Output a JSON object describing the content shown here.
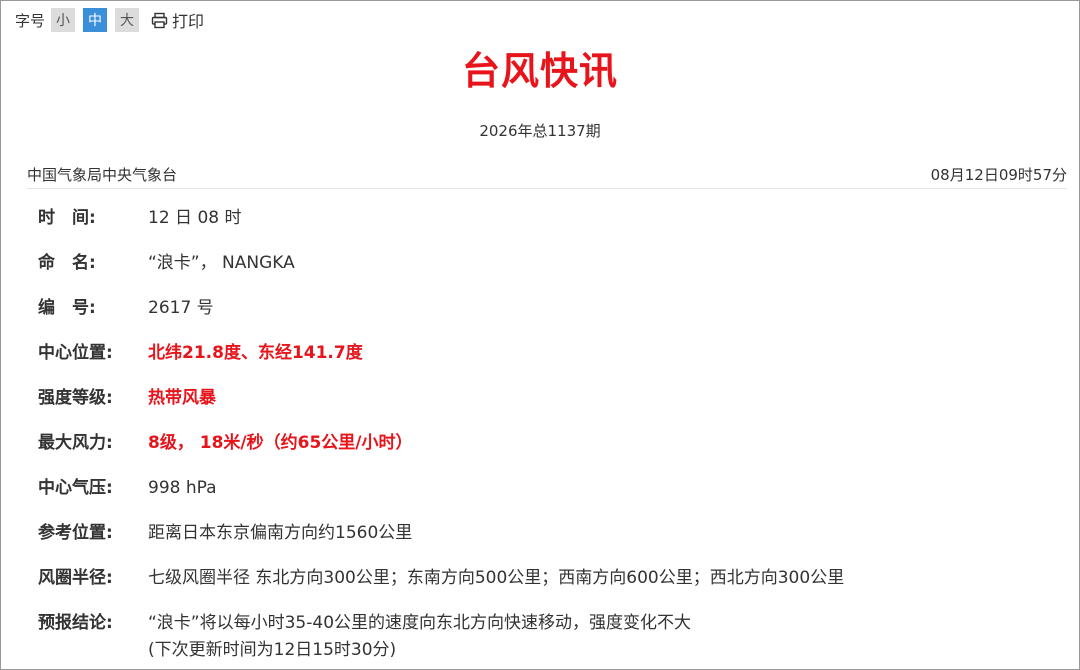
{
  "toolbar": {
    "font_size_label": "字号",
    "sizes": [
      {
        "label": "小",
        "active": false
      },
      {
        "label": "中",
        "active": true
      },
      {
        "label": "大",
        "active": false
      }
    ],
    "print_label": "打印",
    "print_icon": "printer-icon"
  },
  "header": {
    "title": "台风快讯",
    "issue": "2026年总1137期",
    "source": "中国气象局中央气象台",
    "publish_time": "08月12日09时57分"
  },
  "fields": [
    {
      "key": "时　间:",
      "value": "12 日 08 时"
    },
    {
      "key": "命　名:",
      "value": "“浪卡”， NANGKA"
    },
    {
      "key": "编　号:",
      "value": "2617 号"
    },
    {
      "key": "中心位置:",
      "value": "北纬21.8度、东经141.7度"
    },
    {
      "key": "强度等级:",
      "value": "热带风暴"
    },
    {
      "key": "最大风力:",
      "value": "8级， 18米/秒（约65公里/小时）"
    },
    {
      "key": "中心气压:",
      "value": "998 hPa"
    },
    {
      "key": "参考位置:",
      "value": "距离日本东京偏南方向约1560公里"
    },
    {
      "key": "风圈半径:",
      "value": "七级风圈半径 东北方向300公里；东南方向500公里；西南方向600公里；西北方向300公里"
    },
    {
      "key": "预报结论:",
      "value": "“浪卡”将以每小时35-40公里的速度向东北方向快速移动，强度变化不大",
      "value_line2": "(下次更新时间为12日15时30分)"
    }
  ],
  "colors": {
    "accent_red": "#e8141b",
    "active_size_bg": "#3b8fd9",
    "inactive_size_bg": "#dcdcdc"
  }
}
